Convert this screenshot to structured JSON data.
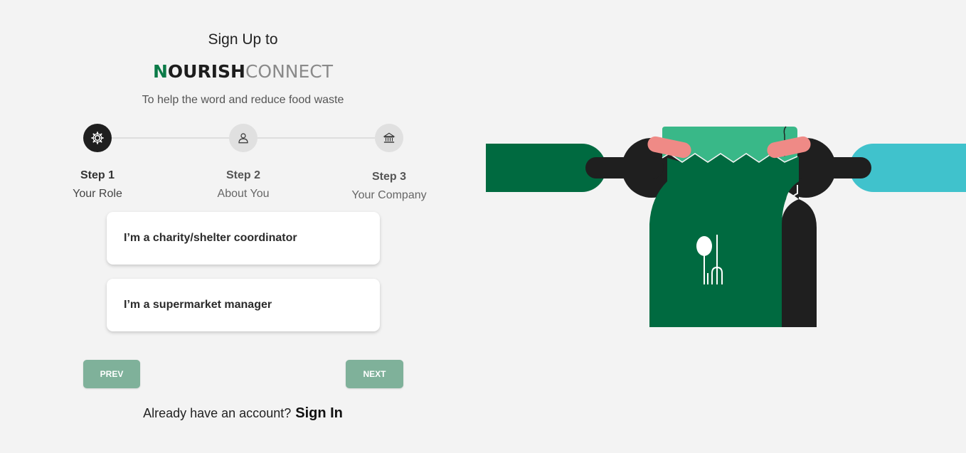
{
  "header": {
    "title": "Sign Up to",
    "brand": {
      "first_letter": "N",
      "rest_bold": "OURISH",
      "light": "CONNECT"
    },
    "tagline": "To help the word and reduce food waste"
  },
  "stepper": {
    "steps": [
      {
        "number": "Step 1",
        "name": "Your Role",
        "icon": "gear-icon",
        "active": true
      },
      {
        "number": "Step 2",
        "name": "About You",
        "icon": "person-icon",
        "active": false
      },
      {
        "number": "Step 3",
        "name": "Your Company",
        "icon": "bank-icon",
        "active": false
      }
    ]
  },
  "roles": [
    {
      "label": "I’m a charity/shelter coordinator"
    },
    {
      "label": "I’m a supermarket manager"
    }
  ],
  "nav": {
    "prev_label": "PREV",
    "next_label": "NEXT"
  },
  "signin": {
    "question": "Already have an account?",
    "link_label": "Sign In"
  },
  "colors": {
    "brand_green": "#0a7a47",
    "button_green": "#7fb19a",
    "dark_green": "#006a40",
    "light_green": "#39b888",
    "teal": "#40c2cc",
    "pink": "#ef8a86",
    "black": "#1f1f1f"
  }
}
